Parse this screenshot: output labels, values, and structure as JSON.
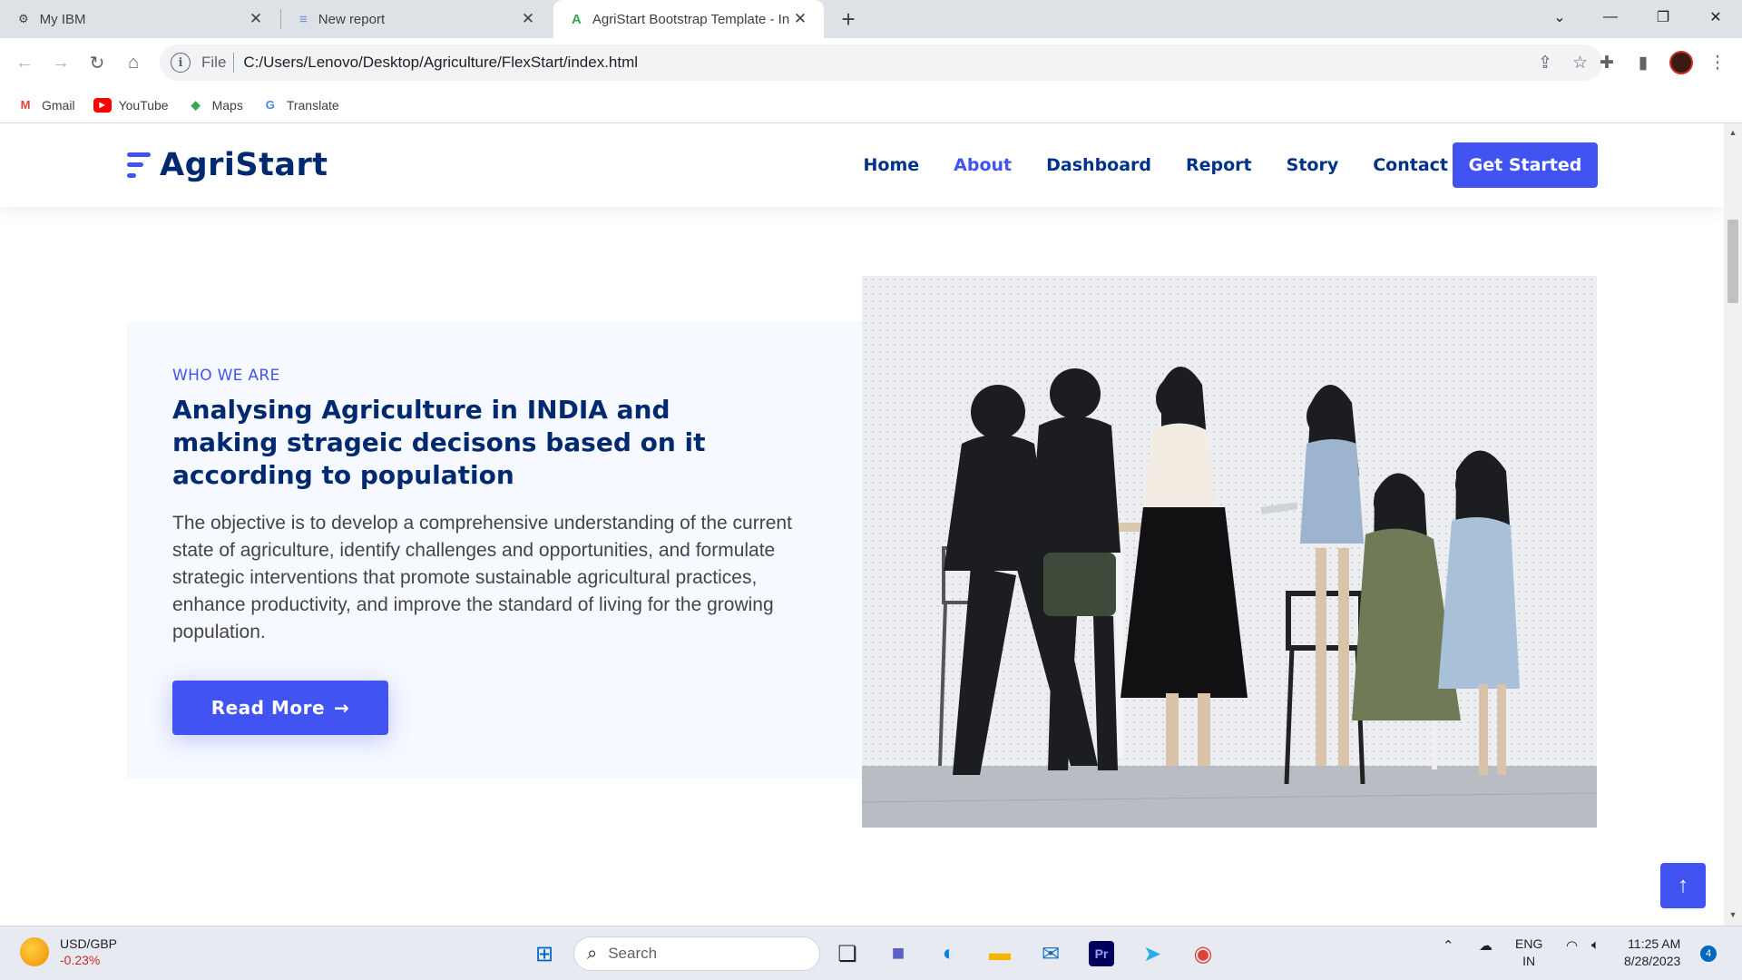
{
  "browser": {
    "tabs": [
      {
        "title": "My IBM",
        "icon": "ibm-icon"
      },
      {
        "title": "New report",
        "icon": "report-icon"
      },
      {
        "title": "AgriStart Bootstrap Template - In",
        "icon": "agristart-icon",
        "active": true
      }
    ],
    "url_scheme": "File",
    "url": "C:/Users/Lenovo/Desktop/Agriculture/FlexStart/index.html",
    "bookmarks": [
      {
        "label": "Gmail",
        "icon": "gmail-icon",
        "color": "#ea4335"
      },
      {
        "label": "YouTube",
        "icon": "youtube-icon",
        "color": "#ff0000"
      },
      {
        "label": "Maps",
        "icon": "maps-icon",
        "color": "#34a853"
      },
      {
        "label": "Translate",
        "icon": "translate-icon",
        "color": "#4285f4"
      }
    ]
  },
  "site": {
    "brand": "AgriStart",
    "nav": [
      {
        "label": "Home"
      },
      {
        "label": "About",
        "active": true
      },
      {
        "label": "Dashboard"
      },
      {
        "label": "Report"
      },
      {
        "label": "Story"
      },
      {
        "label": "Contact"
      }
    ],
    "cta": "Get Started",
    "colors": {
      "primary": "#4154f1",
      "heading": "#012970",
      "section_bg": "#f6f9ff"
    }
  },
  "about": {
    "eyebrow": "WHO WE ARE",
    "heading": "Analysing Agriculture in INDIA and making strageic decisons based on it according to population",
    "description": "The objective is to develop a comprehensive understanding of the current state of agriculture, identify challenges and opportunities, and formulate strategic interventions that promote sustainable agricultural practices, enhance productivity, and improve the standard of living for the growing population.",
    "button": "Read More",
    "button_icon": "arrow-right-icon"
  },
  "taskbar": {
    "ticker_name": "USD/GBP",
    "ticker_change": "-0.23%",
    "search_placeholder": "Search",
    "language": "ENG",
    "region": "IN",
    "time": "11:25 AM",
    "date": "8/28/2023",
    "notifications": "4"
  }
}
